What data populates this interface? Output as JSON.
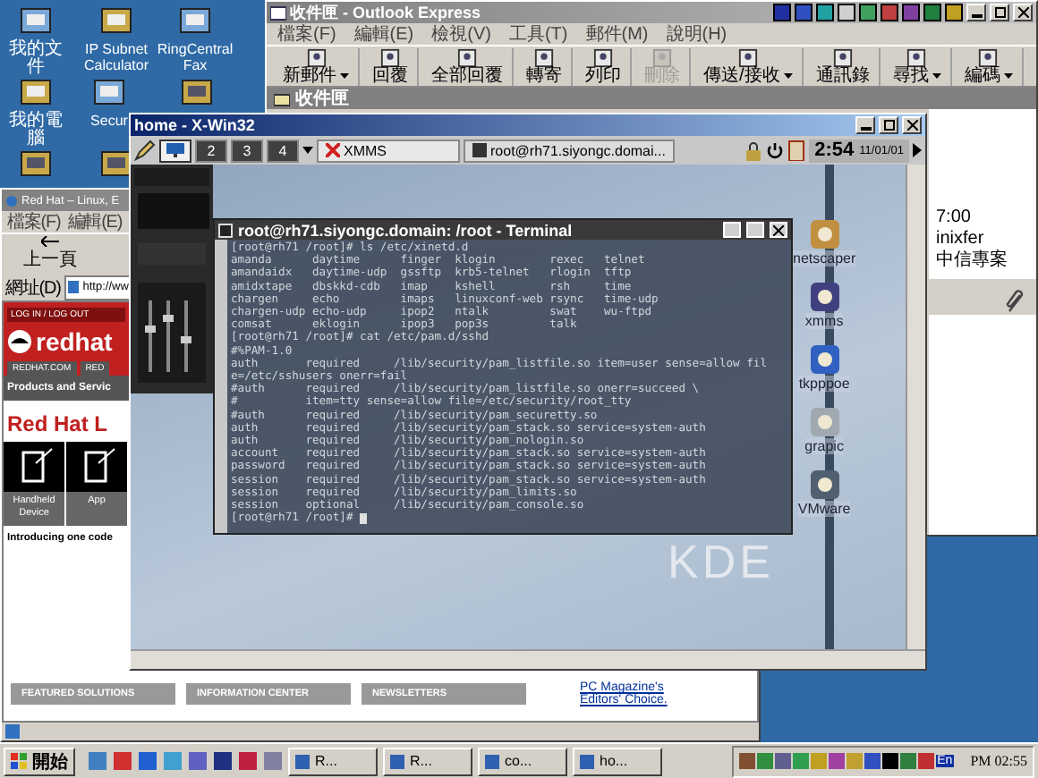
{
  "desktop_icons": [
    {
      "label": "我的文件"
    },
    {
      "label": "IP Subnet Calculator"
    },
    {
      "label": "RingCentral Fax"
    },
    {
      "label": "我的電腦"
    },
    {
      "label": "Secur"
    }
  ],
  "outlook": {
    "title": "收件匣 - Outlook Express",
    "menu": [
      "檔案(F)",
      "編輯(E)",
      "檢視(V)",
      "工具(T)",
      "郵件(M)",
      "說明(H)"
    ],
    "toolbar": [
      {
        "label": "新郵件",
        "disabled": false,
        "dropdown": true
      },
      {
        "label": "回覆",
        "disabled": false,
        "dropdown": false
      },
      {
        "label": "全部回覆",
        "disabled": false,
        "dropdown": false
      },
      {
        "label": "轉寄",
        "disabled": false,
        "dropdown": false
      },
      {
        "label": "列印",
        "disabled": false,
        "dropdown": false
      },
      {
        "label": "刪除",
        "disabled": true,
        "dropdown": false
      },
      {
        "label": "傳送/接收",
        "disabled": false,
        "dropdown": true
      },
      {
        "label": "通訊錄",
        "disabled": false,
        "dropdown": false
      },
      {
        "label": "尋找",
        "disabled": false,
        "dropdown": true
      },
      {
        "label": "編碼",
        "disabled": false,
        "dropdown": true
      }
    ],
    "folder": "收件匣",
    "message_texts": [
      "7:00",
      "inixfer",
      "中信專案"
    ]
  },
  "ie": {
    "title": "Red Hat – Linux, E",
    "menu": [
      "檔案(F)",
      "編輯(E)"
    ],
    "back": "上一頁",
    "address_label": "網址(D)",
    "url": "http://ww",
    "login": "LOG IN / LOG OUT",
    "logo": "redhat",
    "tabs": [
      "REDHAT.COM",
      "RED"
    ],
    "nav": "Products and Servic",
    "heading": "Red Hat L",
    "tiles": [
      "Handheld Device",
      "App"
    ],
    "intro": "Introducing one code",
    "bottom_tabs": [
      "FEATURED SOLUTIONS",
      "INFORMATION CENTER",
      "NEWSLETTERS"
    ],
    "news_links": [
      "PC Magazine's",
      "Editors' Choice."
    ]
  },
  "xwin": {
    "title": "home - X-Win32",
    "desktops": [
      {
        "kind": "icon",
        "selected": true
      },
      {
        "kind": "number",
        "label": "2",
        "selected": false
      },
      {
        "kind": "number",
        "label": "3",
        "selected": false
      },
      {
        "kind": "number",
        "label": "4",
        "selected": false
      }
    ],
    "tasks": [
      {
        "label": "XMMS"
      },
      {
        "label": "root@rh71.siyongc.domai..."
      }
    ],
    "clock": "2:54",
    "date": "11/01/01",
    "kde_icons": [
      "netscaper",
      "xmms",
      "tkpppoe",
      "grapic",
      "VMware"
    ],
    "wallpaper_text": "KDE"
  },
  "terminal": {
    "title": "root@rh71.siyongc.domain: /root - Terminal",
    "lines": [
      "[root@rh71 /root]# ls /etc/xinetd.d",
      "amanda      daytime      finger  klogin        rexec   telnet",
      "amandaidx   daytime-udp  gssftp  krb5-telnet   rlogin  tftp",
      "amidxtape   dbskkd-cdb   imap    kshell        rsh     time",
      "chargen     echo         imaps   linuxconf-web rsync   time-udp",
      "chargen-udp echo-udp     ipop2   ntalk         swat    wu-ftpd",
      "comsat      eklogin      ipop3   pop3s         talk",
      "[root@rh71 /root]# cat /etc/pam.d/sshd",
      "#%PAM-1.0",
      "auth       required     /lib/security/pam_listfile.so item=user sense=allow fil",
      "e=/etc/sshusers onerr=fail",
      "#auth      required     /lib/security/pam_listfile.so onerr=succeed \\",
      "#          item=tty sense=allow file=/etc/security/root_tty",
      "#auth      required     /lib/security/pam_securetty.so",
      "auth       required     /lib/security/pam_stack.so service=system-auth",
      "auth       required     /lib/security/pam_nologin.so",
      "account    required     /lib/security/pam_stack.so service=system-auth",
      "password   required     /lib/security/pam_stack.so service=system-auth",
      "session    required     /lib/security/pam_stack.so service=system-auth",
      "session    required     /lib/security/pam_limits.so",
      "session    optional     /lib/security/pam_console.so",
      "[root@rh71 /root]# "
    ]
  },
  "taskbar": {
    "start": "開始",
    "tasks": [
      {
        "label": "R..."
      },
      {
        "label": "R..."
      },
      {
        "label": "co..."
      },
      {
        "label": "ho..."
      }
    ],
    "lang": "En",
    "time": "PM 02:55"
  }
}
